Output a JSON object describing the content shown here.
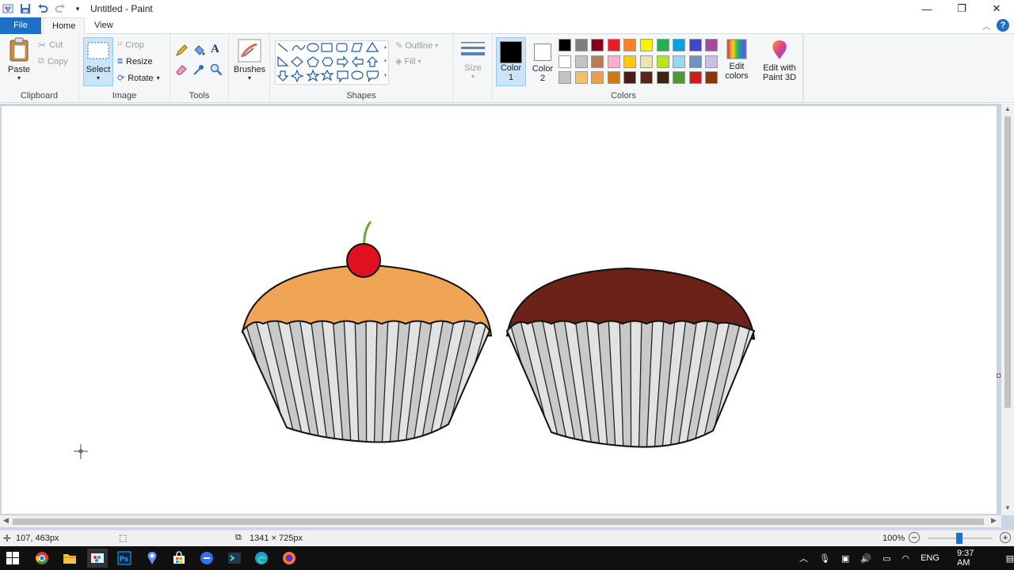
{
  "window": {
    "title": "Untitled - Paint"
  },
  "tabs": [
    {
      "label": "File"
    },
    {
      "label": "Home"
    },
    {
      "label": "View"
    }
  ],
  "clipboard": {
    "paste": "Paste",
    "cut": "Cut",
    "copy": "Copy",
    "group": "Clipboard"
  },
  "image": {
    "select": "Select",
    "crop": "Crop",
    "resize": "Resize",
    "rotate": "Rotate",
    "group": "Image"
  },
  "tools": {
    "group": "Tools"
  },
  "brushes": {
    "label": "Brushes"
  },
  "shapes": {
    "outline": "Outline",
    "fill": "Fill",
    "group": "Shapes"
  },
  "size": {
    "label": "Size"
  },
  "colors": {
    "color1_label": "Color\n1",
    "color2_label": "Color\n2",
    "color1_value": "#000000",
    "color2_value": "#ffffff",
    "edit_colors": "Edit\ncolors",
    "group": "Colors",
    "palette_row1": [
      "#000000",
      "#7f7f7f",
      "#880015",
      "#ed1c24",
      "#ff7f27",
      "#fff200",
      "#22b14c",
      "#00a2e8",
      "#3f48cc",
      "#a349a4"
    ],
    "palette_row2": [
      "#ffffff",
      "#c3c3c3",
      "#b97a57",
      "#ffaec9",
      "#ffc90e",
      "#efe4b0",
      "#b5e61d",
      "#99d9ea",
      "#7092be",
      "#c8bfe7"
    ],
    "palette_row3": [
      "#c3c3c3",
      "#f0c36a",
      "#e8a04a",
      "#d07a13",
      "#4a1d14",
      "#5a2418",
      "#3a2612",
      "#4e9a2e",
      "#d01b1b",
      "#8a3408"
    ]
  },
  "paint3d": {
    "label": "Edit with\nPaint 3D"
  },
  "drawing": {
    "cupcake1_frosting": "#efa456",
    "cupcake2_frosting": "#6a2219",
    "cherry": "#e01020",
    "stem": "#6aa83a",
    "liner_light": "#e2e2e2",
    "liner_dark": "#b4b4b4"
  },
  "status": {
    "cursor_pos": "107, 463px",
    "canvas_size": "1341 × 725px",
    "zoom": "100%"
  },
  "taskbar": {
    "lang": "ENG",
    "time": "9:37 AM"
  }
}
